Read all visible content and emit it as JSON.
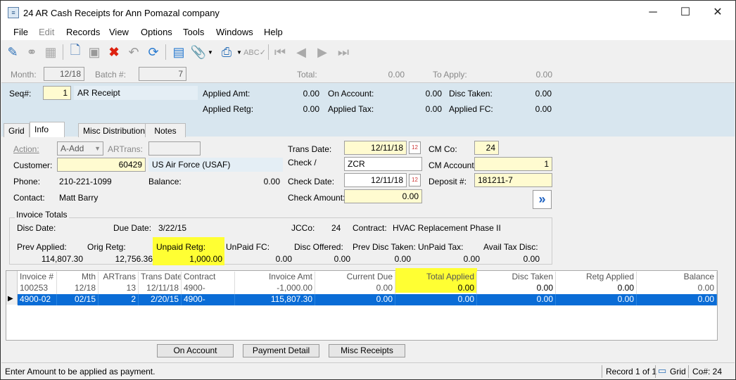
{
  "window": {
    "title": "24 AR Cash Receipts for Ann Pomazal company"
  },
  "menu": [
    "File",
    "Edit",
    "Records",
    "View",
    "Options",
    "Tools",
    "Windows",
    "Help"
  ],
  "header": {
    "month_label": "Month:",
    "month_value": "12/18",
    "batch_label": "Batch #:",
    "batch_value": "7",
    "total_label": "Total:",
    "total_value": "0.00",
    "to_apply_label": "To Apply:",
    "to_apply_value": "0.00"
  },
  "seq": {
    "label": "Seq#:",
    "value": "1",
    "desc": "AR Receipt",
    "applied_amt_label": "Applied Amt:",
    "applied_amt": "0.00",
    "applied_retg_label": "Applied Retg:",
    "applied_retg": "0.00",
    "on_account_label": "On Account:",
    "on_account": "0.00",
    "applied_tax_label": "Applied Tax:",
    "applied_tax": "0.00",
    "disc_taken_label": "Disc Taken:",
    "disc_taken": "0.00",
    "applied_fc_label": "Applied FC:",
    "applied_fc": "0.00"
  },
  "tabs": [
    "Grid",
    "Info",
    "Misc Distributions",
    "Notes"
  ],
  "info": {
    "action_label": "Action:",
    "action_value": "A-Add",
    "artrans_label": "ARTrans:",
    "customer_label": "Customer:",
    "customer_value": "60429",
    "customer_name": "US Air Force (USAF)",
    "phone_label": "Phone:",
    "phone_value": "210-221-1099",
    "balance_label": "Balance:",
    "balance_value": "0.00",
    "contact_label": "Contact:",
    "contact_value": "Matt Barry",
    "trans_date_label": "Trans Date:",
    "trans_date": "12/11/18",
    "check_label": "Check /",
    "check_value": "ZCR",
    "check_date_label": "Check Date:",
    "check_date": "12/11/18",
    "check_amount_label": "Check Amount:",
    "check_amount": "0.00",
    "cm_co_label": "CM Co:",
    "cm_co": "24",
    "cm_account_label": "CM Account:",
    "cm_account": "1",
    "deposit_label": "Deposit #:",
    "deposit": "181211-7"
  },
  "invoice_totals": {
    "group_label": "Invoice Totals",
    "disc_date_label": "Disc Date:",
    "due_date_label": "Due Date:",
    "due_date": "3/22/15",
    "jcco_label": "JCCo:",
    "jcco": "24",
    "contract_label": "Contract:",
    "contract": "HVAC Replacement Phase II",
    "prev_applied_label": "Prev Applied:",
    "prev_applied": "114,807.30",
    "orig_retg_label": "Orig Retg:",
    "orig_retg": "12,756.36",
    "unpaid_retg_label": "Unpaid Retg:",
    "unpaid_retg": "1,000.00",
    "unpaid_fc_label": "UnPaid FC:",
    "unpaid_fc": "0.00",
    "disc_offered_label": "Disc Offered:",
    "disc_offered": "0.00",
    "prev_disc_taken_label": "Prev Disc Taken:",
    "prev_disc_taken": "0.00",
    "unpaid_tax_label": "UnPaid Tax:",
    "unpaid_tax": "0.00",
    "avail_tax_disc_label": "Avail Tax Disc:",
    "avail_tax_disc": "0.00"
  },
  "grid": {
    "columns": [
      "Invoice #",
      "Mth",
      "ARTrans",
      "Trans Date",
      "Contract",
      "Invoice Amt",
      "Current Due",
      "Total Applied",
      "Disc Taken",
      "Retg Applied",
      "Balance"
    ],
    "rows": [
      [
        "100253",
        "12/18",
        "13",
        "12/11/18",
        "4900-",
        "-1,000.00",
        "0.00",
        "0.00",
        "0.00",
        "0.00",
        "0.00"
      ],
      [
        "4900-02",
        "02/15",
        "2",
        "2/20/15",
        "4900-",
        "115,807.30",
        "0.00",
        "0.00",
        "0.00",
        "0.00",
        "0.00"
      ]
    ]
  },
  "buttons": {
    "on_account": "On Account",
    "payment_detail": "Payment Detail",
    "misc_receipts": "Misc Receipts"
  },
  "status": {
    "message": "Enter Amount to be applied as payment.",
    "record": "Record 1 of 1",
    "mode": "Grid",
    "co": "Co#: 24"
  },
  "colors": {
    "highlight": "#ffff33",
    "selected_row": "#0a6cd6",
    "panel_blue": "#d8e6ef",
    "field_yellow": "#fffbd0"
  }
}
